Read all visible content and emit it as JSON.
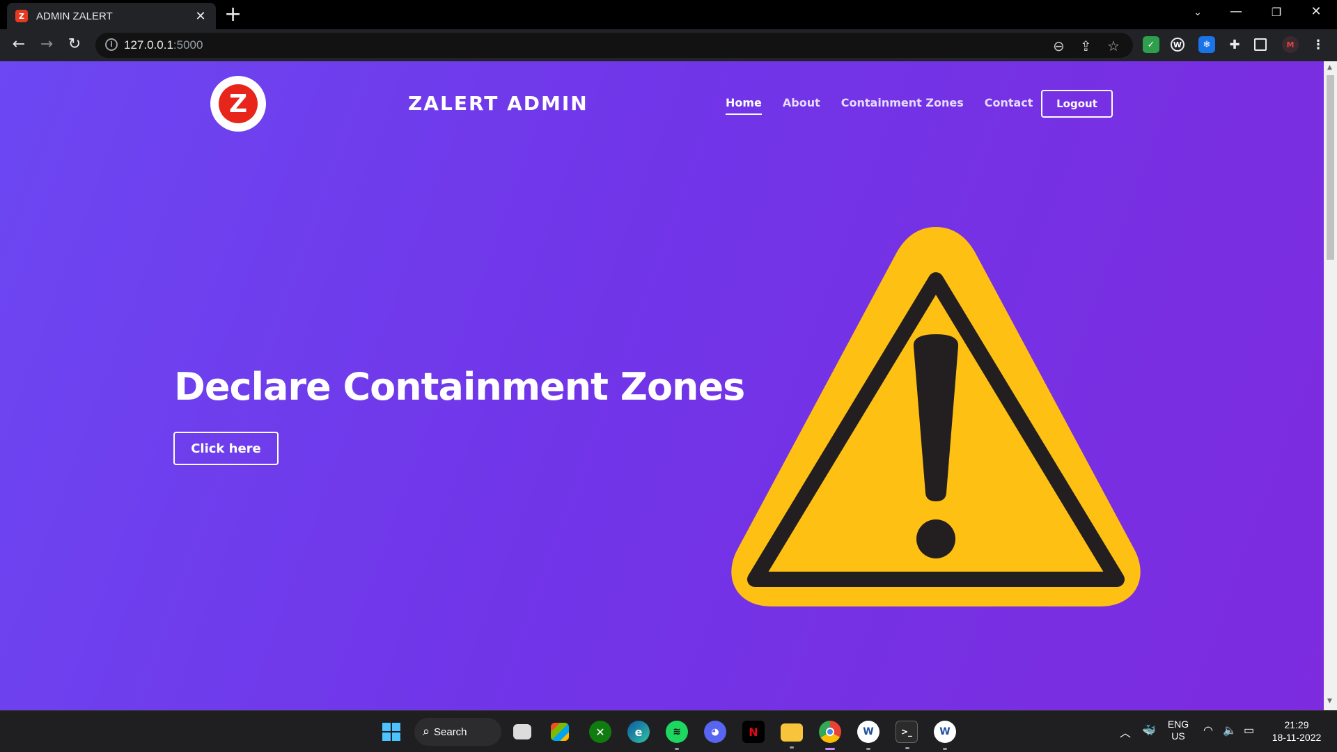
{
  "browser": {
    "tab_title": "ADMIN ZALERT",
    "favicon_letter": "Z",
    "new_tab": "+",
    "url_host": "127.0.0.1",
    "url_port": ":5000"
  },
  "site": {
    "logo_letter": "Z",
    "brand": "ZALERT ADMIN",
    "nav": [
      {
        "label": "Home",
        "active": true
      },
      {
        "label": "About",
        "active": false
      },
      {
        "label": "Containment Zones",
        "active": false
      },
      {
        "label": "Contact",
        "active": false
      }
    ],
    "logout_label": "Logout",
    "headline": "Declare Containment Zones",
    "cta_label": "Click here",
    "warning_icon": "warning-triangle-icon"
  },
  "taskbar": {
    "search_label": "Search",
    "lang_line1": "ENG",
    "lang_line2": "US",
    "time": "21:29",
    "date": "18-11-2022"
  },
  "colors": {
    "page_gradient_start": "#6c47f2",
    "page_gradient_end": "#7d2bdf",
    "warning_yellow": "#ffc014",
    "warning_dark": "#231f20",
    "logo_red": "#e8251a"
  }
}
